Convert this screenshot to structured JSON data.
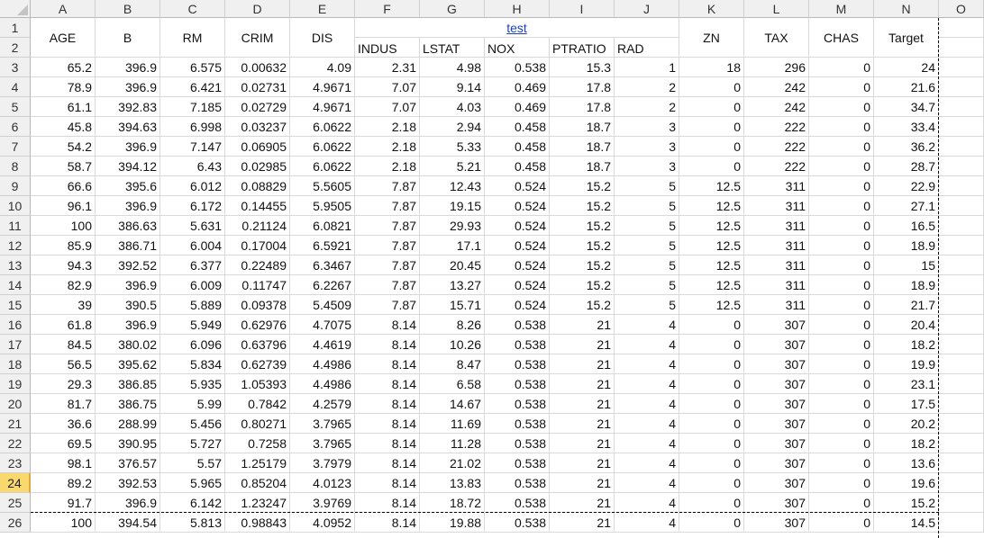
{
  "columns": [
    "A",
    "B",
    "C",
    "D",
    "E",
    "F",
    "G",
    "H",
    "I",
    "J",
    "K",
    "L",
    "M",
    "N",
    "O"
  ],
  "rows": [
    "1",
    "2",
    "3",
    "4",
    "5",
    "6",
    "7",
    "8",
    "9",
    "10",
    "11",
    "12",
    "13",
    "14",
    "15",
    "16",
    "17",
    "18",
    "19",
    "20",
    "21",
    "22",
    "23",
    "24",
    "25",
    "26"
  ],
  "selected_row": "24",
  "header": {
    "AGE": "AGE",
    "B": "B",
    "RM": "RM",
    "CRIM": "CRIM",
    "DIS": "DIS",
    "test": "test",
    "INDUS": "INDUS",
    "LSTAT": "LSTAT",
    "NOX": "NOX",
    "PTRATIO": "PTRATIO",
    "RAD": "RAD",
    "ZN": "ZN",
    "TAX": "TAX",
    "CHAS": "CHAS",
    "Target": "Target"
  },
  "data": [
    [
      "65.2",
      "396.9",
      "6.575",
      "0.00632",
      "4.09",
      "2.31",
      "4.98",
      "0.538",
      "15.3",
      "1",
      "18",
      "296",
      "0",
      "24"
    ],
    [
      "78.9",
      "396.9",
      "6.421",
      "0.02731",
      "4.9671",
      "7.07",
      "9.14",
      "0.469",
      "17.8",
      "2",
      "0",
      "242",
      "0",
      "21.6"
    ],
    [
      "61.1",
      "392.83",
      "7.185",
      "0.02729",
      "4.9671",
      "7.07",
      "4.03",
      "0.469",
      "17.8",
      "2",
      "0",
      "242",
      "0",
      "34.7"
    ],
    [
      "45.8",
      "394.63",
      "6.998",
      "0.03237",
      "6.0622",
      "2.18",
      "2.94",
      "0.458",
      "18.7",
      "3",
      "0",
      "222",
      "0",
      "33.4"
    ],
    [
      "54.2",
      "396.9",
      "7.147",
      "0.06905",
      "6.0622",
      "2.18",
      "5.33",
      "0.458",
      "18.7",
      "3",
      "0",
      "222",
      "0",
      "36.2"
    ],
    [
      "58.7",
      "394.12",
      "6.43",
      "0.02985",
      "6.0622",
      "2.18",
      "5.21",
      "0.458",
      "18.7",
      "3",
      "0",
      "222",
      "0",
      "28.7"
    ],
    [
      "66.6",
      "395.6",
      "6.012",
      "0.08829",
      "5.5605",
      "7.87",
      "12.43",
      "0.524",
      "15.2",
      "5",
      "12.5",
      "311",
      "0",
      "22.9"
    ],
    [
      "96.1",
      "396.9",
      "6.172",
      "0.14455",
      "5.9505",
      "7.87",
      "19.15",
      "0.524",
      "15.2",
      "5",
      "12.5",
      "311",
      "0",
      "27.1"
    ],
    [
      "100",
      "386.63",
      "5.631",
      "0.21124",
      "6.0821",
      "7.87",
      "29.93",
      "0.524",
      "15.2",
      "5",
      "12.5",
      "311",
      "0",
      "16.5"
    ],
    [
      "85.9",
      "386.71",
      "6.004",
      "0.17004",
      "6.5921",
      "7.87",
      "17.1",
      "0.524",
      "15.2",
      "5",
      "12.5",
      "311",
      "0",
      "18.9"
    ],
    [
      "94.3",
      "392.52",
      "6.377",
      "0.22489",
      "6.3467",
      "7.87",
      "20.45",
      "0.524",
      "15.2",
      "5",
      "12.5",
      "311",
      "0",
      "15"
    ],
    [
      "82.9",
      "396.9",
      "6.009",
      "0.11747",
      "6.2267",
      "7.87",
      "13.27",
      "0.524",
      "15.2",
      "5",
      "12.5",
      "311",
      "0",
      "18.9"
    ],
    [
      "39",
      "390.5",
      "5.889",
      "0.09378",
      "5.4509",
      "7.87",
      "15.71",
      "0.524",
      "15.2",
      "5",
      "12.5",
      "311",
      "0",
      "21.7"
    ],
    [
      "61.8",
      "396.9",
      "5.949",
      "0.62976",
      "4.7075",
      "8.14",
      "8.26",
      "0.538",
      "21",
      "4",
      "0",
      "307",
      "0",
      "20.4"
    ],
    [
      "84.5",
      "380.02",
      "6.096",
      "0.63796",
      "4.4619",
      "8.14",
      "10.26",
      "0.538",
      "21",
      "4",
      "0",
      "307",
      "0",
      "18.2"
    ],
    [
      "56.5",
      "395.62",
      "5.834",
      "0.62739",
      "4.4986",
      "8.14",
      "8.47",
      "0.538",
      "21",
      "4",
      "0",
      "307",
      "0",
      "19.9"
    ],
    [
      "29.3",
      "386.85",
      "5.935",
      "1.05393",
      "4.4986",
      "8.14",
      "6.58",
      "0.538",
      "21",
      "4",
      "0",
      "307",
      "0",
      "23.1"
    ],
    [
      "81.7",
      "386.75",
      "5.99",
      "0.7842",
      "4.2579",
      "8.14",
      "14.67",
      "0.538",
      "21",
      "4",
      "0",
      "307",
      "0",
      "17.5"
    ],
    [
      "36.6",
      "288.99",
      "5.456",
      "0.80271",
      "3.7965",
      "8.14",
      "11.69",
      "0.538",
      "21",
      "4",
      "0",
      "307",
      "0",
      "20.2"
    ],
    [
      "69.5",
      "390.95",
      "5.727",
      "0.7258",
      "3.7965",
      "8.14",
      "11.28",
      "0.538",
      "21",
      "4",
      "0",
      "307",
      "0",
      "18.2"
    ],
    [
      "98.1",
      "376.57",
      "5.57",
      "1.25179",
      "3.7979",
      "8.14",
      "21.02",
      "0.538",
      "21",
      "4",
      "0",
      "307",
      "0",
      "13.6"
    ],
    [
      "89.2",
      "392.53",
      "5.965",
      "0.85204",
      "4.0123",
      "8.14",
      "13.83",
      "0.538",
      "21",
      "4",
      "0",
      "307",
      "0",
      "19.6"
    ],
    [
      "91.7",
      "396.9",
      "6.142",
      "1.23247",
      "3.9769",
      "8.14",
      "18.72",
      "0.538",
      "21",
      "4",
      "0",
      "307",
      "0",
      "15.2"
    ],
    [
      "100",
      "394.54",
      "5.813",
      "0.98843",
      "4.0952",
      "8.14",
      "19.88",
      "0.538",
      "21",
      "4",
      "0",
      "307",
      "0",
      "14.5"
    ]
  ]
}
